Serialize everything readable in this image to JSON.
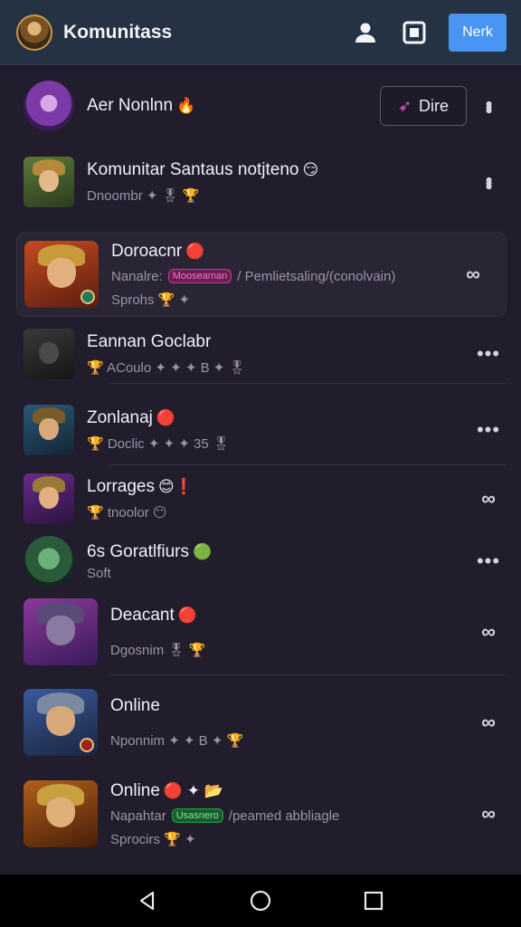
{
  "header": {
    "title": "Komunitass",
    "action_label": "Nerk",
    "icons": [
      "avatar",
      "person-icon",
      "square-icon"
    ],
    "accent": "#4a95f2"
  },
  "list": [
    {
      "name": "Aer Nonlnn",
      "emoji": "🔥",
      "action_label": "Dire",
      "action_icon": "pin-icon",
      "more_icon": "more-vertical-icon"
    },
    {
      "name": "Komunitar Santaus notjteno",
      "emoji": "😏",
      "sub": "Dnoombr",
      "sub_icons": "✦ 🎖 🏆",
      "more_icon": "more-vertical-icon"
    },
    {
      "name": "Doroacnr",
      "emoji": "🔴",
      "sub_prefix": "Nanalre:",
      "tag": "Mooseaman",
      "sub_suffix": "/ Pemlietsaling/(conolvain)",
      "sub2": "Sprohs 🏆 ✦",
      "more_icon": "link-icon",
      "highlight": true
    },
    {
      "name": "Eannan Goclabr",
      "sub": "🏆 ACoulo ✦ ✦ ✦ B ✦ 🎖",
      "more_icon": "more-horizontal-icon"
    },
    {
      "name": "Zonlanaj",
      "emoji": "🔴",
      "sub": "🏆 Doclic ✦ ✦ ✦ 35 🎖",
      "more_icon": "more-horizontal-icon"
    },
    {
      "name": "Lorrages",
      "emoji": "😊❗",
      "sub": "🏆 tnoolor 😶",
      "more_icon": "link-icon"
    },
    {
      "name": "6s Goratlfiurs",
      "emoji": "🟢",
      "sub": "Soft",
      "more_icon": "more-horizontal-icon"
    },
    {
      "name": "Deacant",
      "emoji": "🔴",
      "sub": "Dgosnim 🎖 🏆",
      "more_icon": "link-icon"
    },
    {
      "name": "Online",
      "sub": "Nponnim ✦ ✦ B ✦ 🏆",
      "more_icon": "link-icon"
    },
    {
      "name": "Online",
      "emoji": "🔴 ✦ 📂",
      "sub_prefix": "Napahtar",
      "tag": "Usasnero",
      "sub_suffix": "/peamed abbliagle",
      "sub2": "Sprocirs 🏆 ✦",
      "more_icon": "link-icon"
    }
  ],
  "nav": {
    "back": "back-icon",
    "home": "home-icon",
    "recents": "recents-icon"
  }
}
